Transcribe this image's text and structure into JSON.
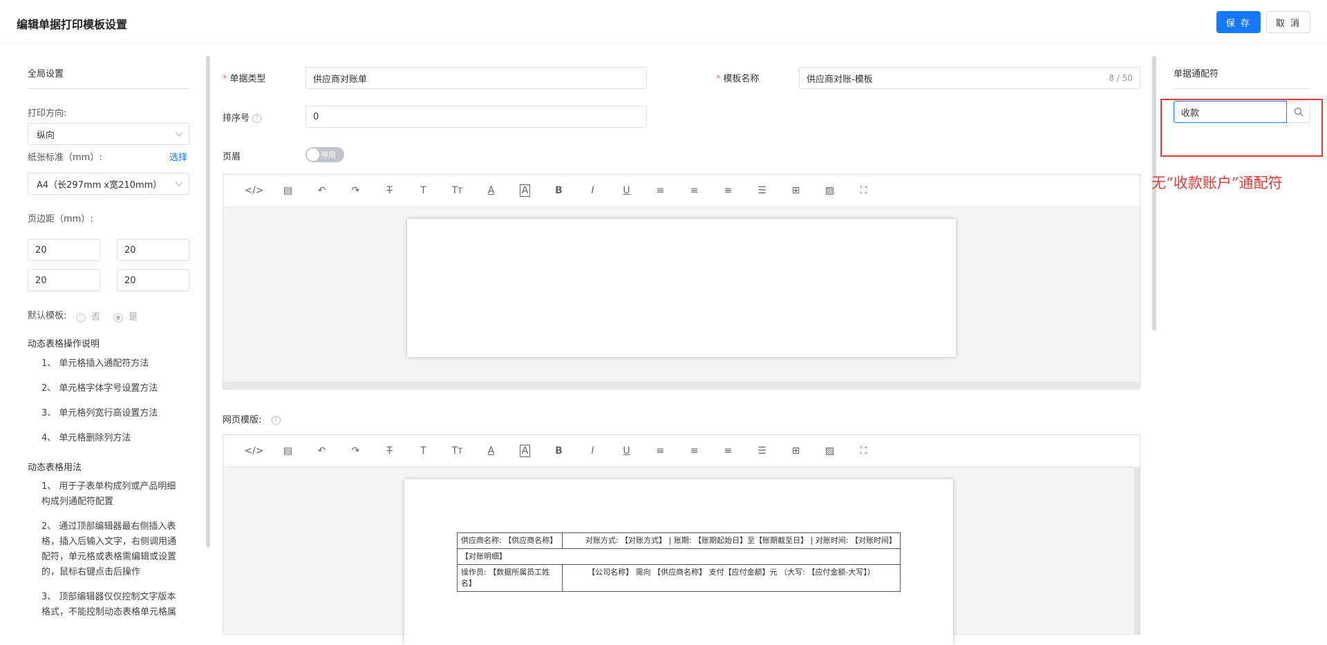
{
  "header": {
    "title": "编辑单据打印模板设置",
    "save_label": "保 存",
    "cancel_label": "取 消"
  },
  "global": {
    "title": "全局设置",
    "orientation_label": "打印方向:",
    "orientation_value": "纵向",
    "paper_label": "纸张标准（mm）:",
    "paper_select_link": "选择",
    "paper_value": "A4（长297mm x宽210mm）",
    "margin_label": "页边距（mm）:",
    "margins": [
      "20",
      "20",
      "20",
      "20"
    ],
    "default_label": "默认模板:",
    "default_no": "否",
    "default_yes": "是"
  },
  "help": {
    "ops_title": "动态表格操作说明",
    "ops": [
      "1、 单元格插入通配符方法",
      "2、 单元格字体字号设置方法",
      "3、 单元格列宽行高设置方法",
      "4、 单元格删除列方法"
    ],
    "usage_title": "动态表格用法",
    "usage_1a": "1、 用于子表单构成列或产品明细",
    "usage_1b": "构成列通配符配置",
    "usage_2a": "2、 通过顶部编辑器最右侧插入表",
    "usage_2b": "格，插入后输入文字，右侧调用通",
    "usage_2c": "配符，单元格或表格需编辑或设置",
    "usage_2d": "的，鼠标右键点击后操作",
    "usage_3a": "3、 顶部编辑器仅仅控制文字版本",
    "usage_3b": "格式，不能控制动态表格单元格属"
  },
  "form": {
    "doc_type_label": "单据类型",
    "doc_type_value": "供应商对账单",
    "template_name_label": "模板名称",
    "template_name_value": "供应商对账-模板",
    "template_name_count": "8 / 50",
    "sort_label": "排序号",
    "sort_value": "0",
    "header_label": "页眉",
    "header_switch": "停用",
    "web_template_label": "网页模版:"
  },
  "toolbar_icons": [
    "code-icon",
    "template-icon",
    "undo-icon",
    "redo-icon",
    "strikethrough-icon",
    "font-size-icon",
    "text-size-icon",
    "font-color-icon",
    "background-color-icon",
    "bold-icon",
    "italic-icon",
    "underline-icon",
    "align-left-icon",
    "align-center-icon",
    "align-right-icon",
    "line-height-icon",
    "table-icon",
    "image-icon",
    "fullscreen-icon"
  ],
  "template_table": {
    "r1c1": "供应商名称: 【供应商名称】",
    "r1c2": "对账方式: 【对账方式】 | 账期: 【账期起始日】至【账期截至日】 | 对账时间: 【对账时间】",
    "r2": "【对账明细】",
    "r3c1": "操作员: 【数据所属员工姓名】",
    "r3c2": "【公司名称】 需向 【供应商名称】 支付【应付金额】元 （大写: 【应付金额-大写】）"
  },
  "wildcard": {
    "title": "单据通配符",
    "search_value": "收款"
  },
  "annotation": "无“收款账户”通配符",
  "colors": {
    "primary": "#1677ff",
    "annotation": "#e53935"
  }
}
